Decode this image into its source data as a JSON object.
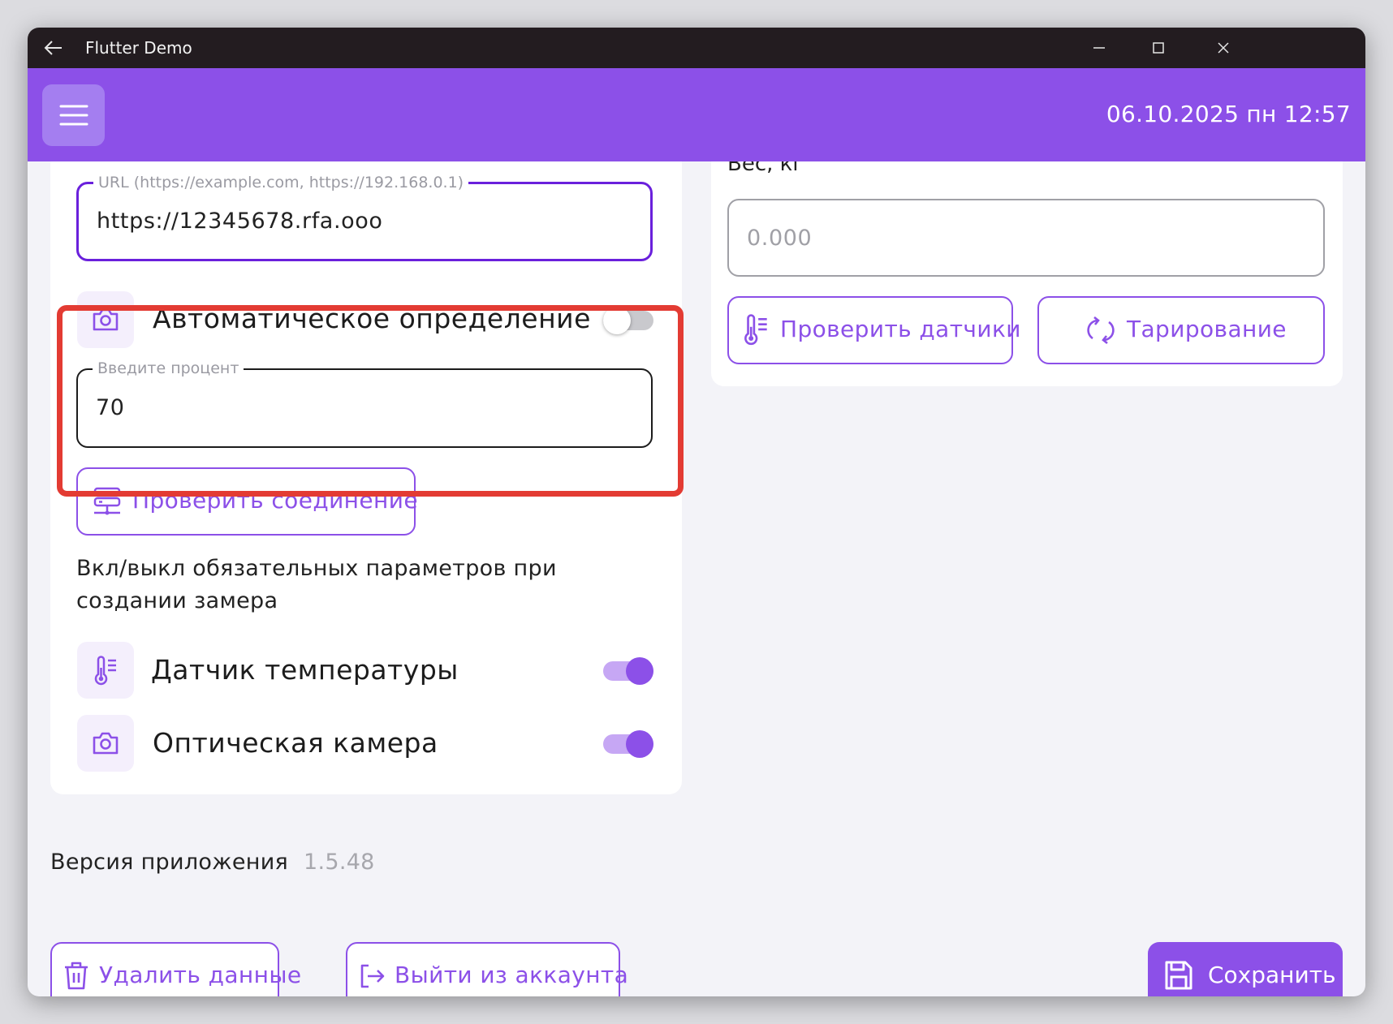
{
  "window": {
    "title": "Flutter Demo"
  },
  "appbar": {
    "datetime": "06.10.2025 пн 12:57"
  },
  "connection": {
    "url_label": "URL (https://example.com, https://192.168.0.1)",
    "url_value": "https://12345678.rfa.ooo",
    "auto_detect_label": "Автоматическое определение",
    "auto_detect_on": false,
    "percent_label": "Введите процент",
    "percent_value": "70",
    "check_connection_label": "Проверить соединение"
  },
  "params": {
    "description": "Вкл/выкл обязательных параметров при создании замера",
    "items": [
      {
        "label": "Датчик температуры",
        "icon": "thermometer-icon",
        "enabled": true
      },
      {
        "label": "Оптическая камера",
        "icon": "camera-icon",
        "enabled": true
      }
    ]
  },
  "weight": {
    "label": "Вес, кг",
    "placeholder": "0.000",
    "check_sensors_label": "Проверить датчики",
    "tare_label": "Тарирование"
  },
  "version": {
    "label": "Версия приложения",
    "value": "1.5.48"
  },
  "footer": {
    "delete_label": "Удалить данные",
    "logout_label": "Выйти из аккаунта",
    "save_label": "Сохранить"
  },
  "colors": {
    "accent": "#8c50e8",
    "titlebar": "#231c20",
    "highlight": "#e33b33"
  }
}
